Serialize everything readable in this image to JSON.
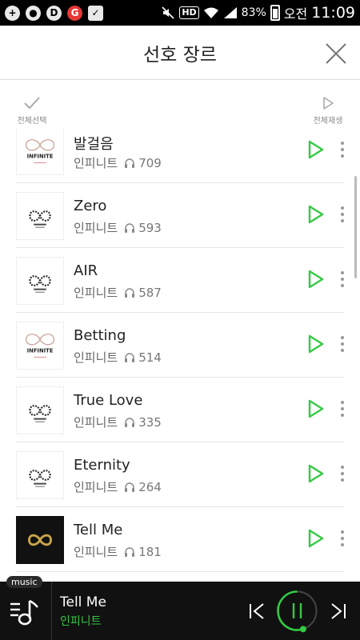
{
  "status_bar": {
    "hd": "HD",
    "battery": "83%",
    "ampm": "오전",
    "time": "11:09"
  },
  "header": {
    "title": "선호 장르"
  },
  "toolbar": {
    "select_all": "전체선택",
    "play_all": "전체재생"
  },
  "songs": [
    {
      "title": "발걸음",
      "artist": "인피니트",
      "plays": "709",
      "art": "light-infinite"
    },
    {
      "title": "Zero",
      "artist": "인피니트",
      "plays": "593",
      "art": "infinity-logo"
    },
    {
      "title": "AIR",
      "artist": "인피니트",
      "plays": "587",
      "art": "infinity-logo"
    },
    {
      "title": "Betting",
      "artist": "인피니트",
      "plays": "514",
      "art": "light-infinite"
    },
    {
      "title": "True Love",
      "artist": "인피니트",
      "plays": "335",
      "art": "infinity-logo"
    },
    {
      "title": "Eternity",
      "artist": "인피니트",
      "plays": "264",
      "art": "infinity-logo"
    },
    {
      "title": "Tell Me",
      "artist": "인피니트",
      "plays": "181",
      "art": "dark-gold"
    }
  ],
  "player": {
    "badge": "music",
    "title": "Tell Me",
    "artist": "인피니트",
    "progress": 0.55
  },
  "colors": {
    "accent": "#35c944",
    "player_bg": "#111111"
  }
}
